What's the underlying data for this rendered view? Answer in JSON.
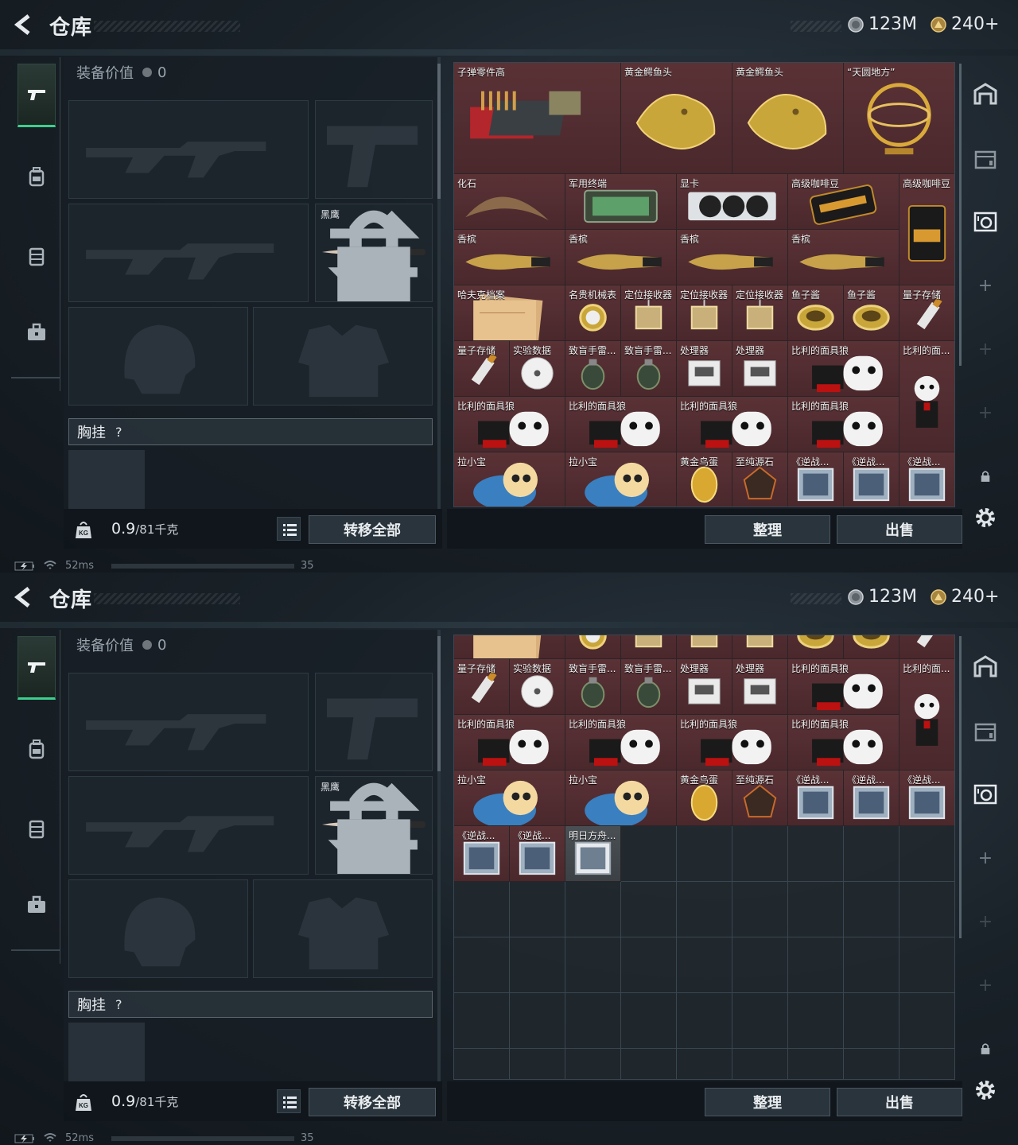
{
  "header": {
    "title": "仓库",
    "currency_1": "123M",
    "currency_2": "240+"
  },
  "equipment": {
    "value_label": "装备价值",
    "value": "0",
    "knife_name": "黑鹰",
    "chest_label": "胸挂",
    "chest_help": "?",
    "weight_value": "0.9",
    "weight_unit": "/81千克",
    "weight_icon_text": "KG",
    "transfer_all": "转移全部"
  },
  "actions": {
    "sort": "整理",
    "sell": "出售"
  },
  "status": {
    "ping": "52ms",
    "fps": "35"
  },
  "icons": [
    "back-arrow-icon",
    "silver-coin-icon",
    "gold-coin-icon",
    "pistol-icon",
    "backpack-icon",
    "armor-vest-icon",
    "case-icon",
    "swap-icon",
    "lock-icon",
    "kg-weight-icon",
    "list-icon",
    "warehouse-icon",
    "container-icon",
    "safe-icon",
    "plus-icon",
    "settings-gear-icon"
  ],
  "colors": {
    "rarity_red": "#5a3236",
    "rarity_gray": "#4a4f54",
    "active_tab": "#3ccf8e"
  },
  "items_view1": [
    {
      "name": "子弹零件高"
    },
    {
      "name": "黄金鳄鱼头"
    },
    {
      "name": "黄金鳄鱼头"
    },
    {
      "name": "“天圆地方”"
    },
    {
      "name": "化石"
    },
    {
      "name": "军用终端"
    },
    {
      "name": "显卡"
    },
    {
      "name": "高级咖啡豆"
    },
    {
      "name": "高级咖啡豆"
    },
    {
      "name": "香槟"
    },
    {
      "name": "香槟"
    },
    {
      "name": "香槟"
    },
    {
      "name": "香槟"
    },
    {
      "name": "哈夫克档案"
    },
    {
      "name": "名贵机械表"
    },
    {
      "name": "定位接收器"
    },
    {
      "name": "定位接收器"
    },
    {
      "name": "定位接收器"
    },
    {
      "name": "鱼子酱"
    },
    {
      "name": "鱼子酱"
    },
    {
      "name": "量子存储"
    },
    {
      "name": "量子存储"
    },
    {
      "name": "实验数据"
    },
    {
      "name": "致盲手雷..."
    },
    {
      "name": "致盲手雷..."
    },
    {
      "name": "处理器"
    },
    {
      "name": "处理器"
    },
    {
      "name": "比利的面具狼"
    },
    {
      "name": "比利的面..."
    },
    {
      "name": "比利的面具狼"
    },
    {
      "name": "比利的面具狼"
    },
    {
      "name": "比利的面具狼"
    },
    {
      "name": "比利的面具狼"
    },
    {
      "name": "拉小宝"
    },
    {
      "name": "拉小宝"
    },
    {
      "name": "黄金鸟蛋"
    },
    {
      "name": "至纯源石"
    },
    {
      "name": "《逆战..."
    },
    {
      "name": "《逆战..."
    },
    {
      "name": "《逆战..."
    }
  ],
  "items_view2": [
    {
      "name": ""
    },
    {
      "name": ""
    },
    {
      "name": ""
    },
    {
      "name": ""
    },
    {
      "name": ""
    },
    {
      "name": ""
    },
    {
      "name": ""
    },
    {
      "name": ""
    },
    {
      "name": "量子存储"
    },
    {
      "name": "实验数据"
    },
    {
      "name": "致盲手雷..."
    },
    {
      "name": "致盲手雷..."
    },
    {
      "name": "处理器"
    },
    {
      "name": "处理器"
    },
    {
      "name": "比利的面具狼"
    },
    {
      "name": "比利的面..."
    },
    {
      "name": "比利的面具狼"
    },
    {
      "name": "比利的面具狼"
    },
    {
      "name": "比利的面具狼"
    },
    {
      "name": "比利的面具狼"
    },
    {
      "name": "拉小宝"
    },
    {
      "name": "拉小宝"
    },
    {
      "name": "黄金鸟蛋"
    },
    {
      "name": "至纯源石"
    },
    {
      "name": "《逆战..."
    },
    {
      "name": "《逆战..."
    },
    {
      "name": "《逆战..."
    },
    {
      "name": "《逆战..."
    },
    {
      "name": "《逆战..."
    },
    {
      "name": "明日方舟..."
    }
  ]
}
